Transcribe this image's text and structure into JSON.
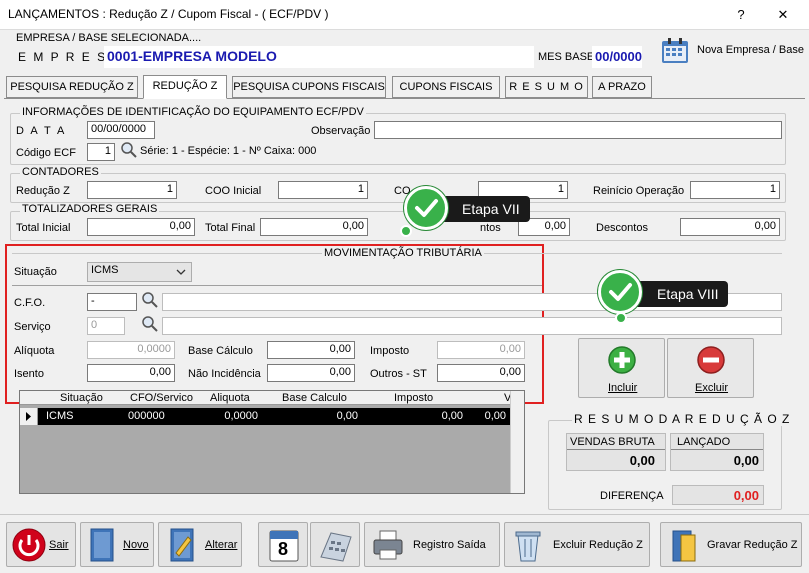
{
  "window": {
    "title": "LANÇAMENTOS : Redução Z / Cupom Fiscal - ( ECF/PDV )",
    "help": "?",
    "close": "✕"
  },
  "empresa": {
    "section": "EMPRESA  /  BASE  SELECIONADA....",
    "label": "E M P R E S A",
    "value": "0001-EMPRESA MODELO",
    "mes_label": "MES BASE",
    "mes_value": "00/0000",
    "nova": "Nova Empresa / Base"
  },
  "tabs": [
    "PESQUISA REDUÇÃO Z",
    "REDUÇÃO Z",
    "PESQUISA CUPONS FISCAIS",
    "CUPONS FISCAIS",
    "R E S U M O",
    "A PRAZO"
  ],
  "info": {
    "section": "INFORMAÇÕES DE IDENTIFICAÇÃO DO EQUIPAMENTO ECF/PDV",
    "data_label": "D A T A",
    "data_value": "00/00/0000",
    "obs_label": "Observação",
    "ecf_label": "Código ECF",
    "ecf_value": "1",
    "ecf_info": "Série: 1  -  Espécie: 1  -  Nº Caixa: 000"
  },
  "contadores": {
    "section": "CONTADORES",
    "reducao_label": "Redução Z",
    "reducao_value": "1",
    "coo_label": "COO  Inicial",
    "coo_value": "1",
    "co_label": "CO",
    "co_value": "1",
    "reinicio_label": "Reinício Operação",
    "reinicio_value": "1"
  },
  "totalizadores": {
    "section": "TOTALIZADORES  GERAIS",
    "ti_label": "Total Inicial",
    "ti_value": "0,00",
    "tf_label": "Total Final",
    "tf_value": "0,00",
    "cancel_label": "ntos",
    "cancel_value": "0,00",
    "desc_label": "Descontos",
    "desc_value": "0,00"
  },
  "mov": {
    "section": "MOVIMENTAÇÃO TRIBUTÁRIA",
    "situacao_label": "Situação",
    "situacao_value": "ICMS",
    "cfo_label": "C.F.O.",
    "cfo_value": "-",
    "servico_label": "Serviço",
    "servico_value": "0",
    "aliquota_label": "Alíquota",
    "aliquota_value": "0,0000",
    "base_label": "Base Cálculo",
    "base_value": "0,00",
    "imposto_label": "Imposto",
    "imposto_value": "0,00",
    "isento_label": "Isento",
    "isento_value": "0,00",
    "naoinc_label": "Não Incidência",
    "naoinc_value": "0,00",
    "outros_label": "Outros - ST",
    "outros_value": "0,00"
  },
  "grid": {
    "headers": [
      "Situação",
      "CFO/Servico",
      "Aliquota",
      "Base Calculo",
      "Imposto",
      "V"
    ],
    "row": [
      "ICMS",
      "000000",
      "0,0000",
      "0,00",
      "0,00",
      "0,00"
    ]
  },
  "callouts": {
    "vii": "Etapa VII",
    "viii": "Etapa VIII"
  },
  "actions": {
    "incluir": "Incluir",
    "excluir": "Excluir"
  },
  "resumo": {
    "title": "R E S U M O   D A   R E D U Ç Ã O   Z",
    "vendas_label": "VENDAS BRUTA",
    "vendas_value": "0,00",
    "lanc_label": "LANÇADO",
    "lanc_value": "0,00",
    "dif_label": "DIFERENÇA",
    "dif_value": "0,00"
  },
  "bottom": {
    "sair": "Sair",
    "novo": "Novo",
    "alterar": "Alterar",
    "calendar_day": "8",
    "registro": "Registro Saída",
    "excluir": "Excluir Redução Z",
    "gravar": "Gravar Redução Z"
  },
  "colors": {
    "brand_blue": "#1a1ab0",
    "highlight_red": "#e02020",
    "check_green": "#39b14a"
  }
}
